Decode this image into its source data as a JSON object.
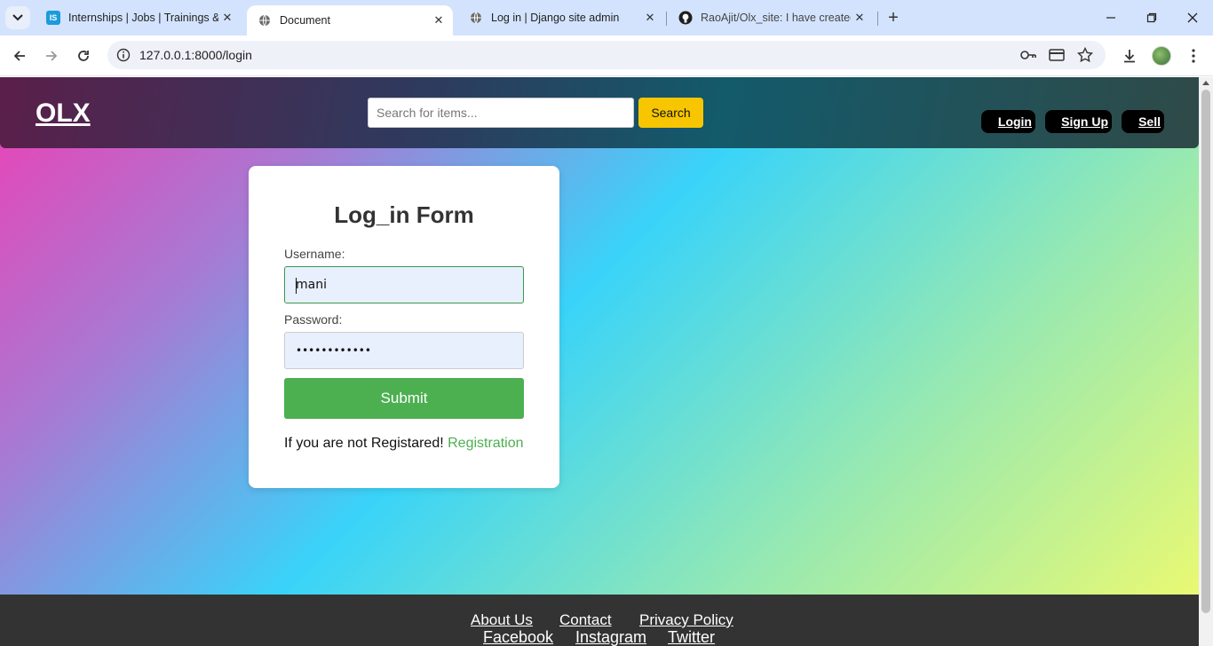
{
  "browser": {
    "tabs": [
      {
        "title": "Internships | Jobs | Trainings & I",
        "favicon": "internshala-icon",
        "active": false
      },
      {
        "title": "Document",
        "favicon": "globe-icon",
        "active": true
      },
      {
        "title": "Log in | Django site admin",
        "favicon": "globe-icon",
        "active": false
      },
      {
        "title": "RaoAjit/Olx_site: I have created",
        "favicon": "github-icon",
        "active": false
      }
    ],
    "favicon_label_is": "IS",
    "url": "127.0.0.1:8000/login"
  },
  "header": {
    "logo": "OLX",
    "search_placeholder": "Search for items...",
    "search_button": "Search",
    "nav": {
      "login": "Login",
      "signup": "Sign Up",
      "sell": "Sell"
    }
  },
  "form": {
    "title": "Log_in Form",
    "username_label": "Username:",
    "username_value": "mani",
    "password_label": "Password:",
    "password_value": "••••••••••••",
    "submit": "Submit",
    "register_prompt": "If you are not Registared!",
    "register_link": "Registration"
  },
  "footer": {
    "links_row1": {
      "about": "About Us",
      "contact": "Contact",
      "privacy": "Privacy Policy"
    },
    "links_row2": {
      "facebook": "Facebook",
      "instagram": "Instagram",
      "twitter": "Twitter"
    }
  },
  "colors": {
    "accent_green": "#4caf50",
    "search_yellow": "#f7c600",
    "footer_bg": "#333333"
  }
}
